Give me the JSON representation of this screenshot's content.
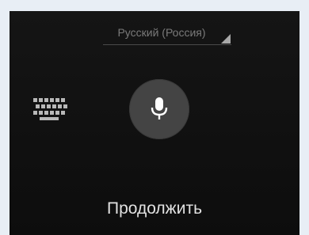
{
  "language": {
    "label": "Русский (Россия)"
  },
  "actions": {
    "continue_label": "Продолжить"
  },
  "icons": {
    "keyboard": "keyboard-icon",
    "microphone": "microphone-icon",
    "dropdown": "dropdown-triangle-icon"
  },
  "colors": {
    "background": "#111111",
    "mic_button": "#444444",
    "text_primary": "#e2e2e2",
    "text_secondary": "#7a7a7a"
  }
}
